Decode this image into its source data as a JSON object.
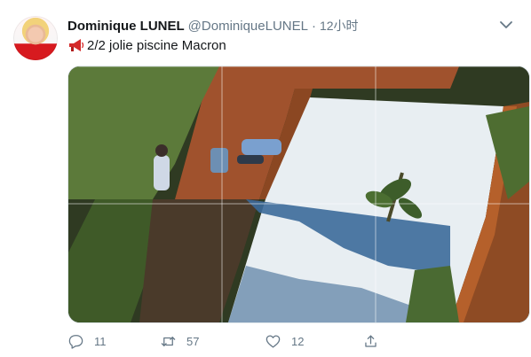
{
  "tweet": {
    "author_name": "Dominique LUNEL",
    "author_handle": "@DominiqueLUNEL",
    "separator": "·",
    "time": "12小时",
    "text": "2/2 jolie piscine Macron",
    "text_emoji_icon": "megaphone-icon",
    "media": {
      "description_icon": "photo-pool-aerial"
    },
    "actions": {
      "reply_count": "11",
      "retweet_count": "57",
      "like_count": "12"
    }
  },
  "colors": {
    "text_primary": "#14171a",
    "text_secondary": "#657786",
    "border": "#e1e8ed",
    "megaphone_red": "#d42a2a"
  }
}
